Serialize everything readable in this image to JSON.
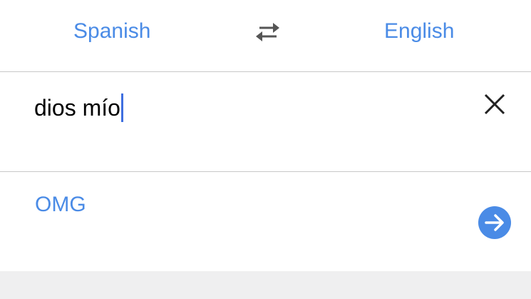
{
  "languages": {
    "source": "Spanish",
    "target": "English",
    "swap_icon": "swap-arrows-icon"
  },
  "input": {
    "value": "dios mío",
    "clear_icon": "close-icon"
  },
  "result": {
    "text": "OMG",
    "go_icon": "arrow-right-icon"
  },
  "colors": {
    "accent": "#4a8be6",
    "divider": "#c8c8c8",
    "caret": "#3f6fe0",
    "bottom_panel": "#efeff0"
  }
}
